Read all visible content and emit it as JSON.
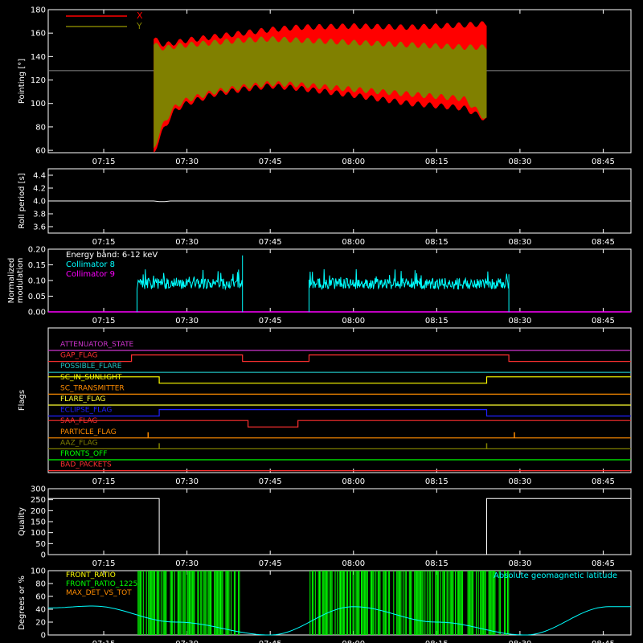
{
  "colors": {
    "x_series": "#ff0000",
    "y_series": "#808000",
    "collimator8": "#00ffff",
    "collimator9": "#ff00ff",
    "axis": "#ffffff",
    "front_ratio": "#ffff00",
    "front_ratio_1225": "#00ff00",
    "max_det": "#ff8c00",
    "geomag": "#00ffff"
  },
  "time_ticks": [
    "07:15",
    "07:30",
    "07:45",
    "08:00",
    "08:15",
    "08:30",
    "08:45"
  ],
  "chart_data": [
    {
      "type": "area",
      "ylabel": "Pointing [°]",
      "ylim": [
        58,
        180
      ],
      "yticks": [
        "180",
        "160",
        "140",
        "120",
        "100",
        "80",
        "60"
      ],
      "grid": false,
      "legend_placement": "top-left",
      "x_range": [
        "07:05",
        "08:50"
      ],
      "reference_line": 128,
      "series": [
        {
          "name": "X",
          "start": "07:24",
          "end": "08:24",
          "x": [
            "07:24",
            "07:26",
            "07:28",
            "07:30",
            "07:35",
            "07:40",
            "07:45",
            "07:50",
            "08:00",
            "08:10",
            "08:20",
            "08:24"
          ],
          "max": [
            155,
            150,
            152,
            154,
            157,
            160,
            163,
            165,
            166,
            165,
            167,
            168
          ],
          "min": [
            58,
            80,
            95,
            100,
            108,
            112,
            115,
            113,
            107,
            100,
            96,
            86
          ]
        },
        {
          "name": "Y",
          "start": "07:24",
          "end": "08:24",
          "x": [
            "07:24",
            "07:26",
            "07:28",
            "07:30",
            "07:35",
            "07:40",
            "07:45",
            "07:50",
            "08:00",
            "08:10",
            "08:20",
            "08:24"
          ],
          "max": [
            150,
            147,
            149,
            150,
            152,
            154,
            155,
            154,
            152,
            150,
            148,
            148
          ],
          "min": [
            62,
            85,
            98,
            103,
            110,
            114,
            117,
            116,
            112,
            108,
            104,
            86
          ]
        }
      ]
    },
    {
      "type": "line",
      "ylabel": "Roll period [s]",
      "ylim": [
        3.5,
        4.5
      ],
      "yticks": [
        "4.4",
        "4.2",
        "4.0",
        "3.8",
        "3.6"
      ],
      "grid": false,
      "series": [
        {
          "name": "",
          "x": [
            "07:05",
            "07:24",
            "07:25",
            "07:26",
            "07:27",
            "08:50"
          ],
          "values": [
            4.0,
            4.0,
            3.99,
            3.99,
            4.0,
            4.0
          ]
        }
      ]
    },
    {
      "type": "line",
      "ylabel": "Normalized modulation",
      "ylim": [
        0,
        0.2
      ],
      "yticks": [
        "0.20",
        "0.15",
        "0.10",
        "0.05",
        "0.00"
      ],
      "grid": false,
      "legend_placement": "top-left",
      "legend_title": "Energy band: 6-12 keV",
      "series": [
        {
          "name": "Collimator 8",
          "segments": [
            {
              "start": "07:21",
              "end": "07:40",
              "mean": 0.09,
              "peaks": [
                [
                  "07:21.5",
                  0.14
                ],
                [
                  "07:40",
                  0.18
                ]
              ]
            },
            {
              "start": "07:52",
              "end": "08:28",
              "mean": 0.09,
              "peaks": [
                [
                  "07:52.5",
                  0.13
                ],
                [
                  "08:28",
                  0.12
                ]
              ]
            }
          ]
        },
        {
          "name": "Collimator 9",
          "values": [
            0.0
          ]
        }
      ]
    },
    {
      "type": "line",
      "ylabel": "Flags",
      "grid": false,
      "flags": [
        {
          "name": "ATTENUATOR_STATE",
          "color": "#cc33cc",
          "transitions": []
        },
        {
          "name": "GAP_FLAG",
          "color": "#ff3030",
          "transitions": [
            [
              "07:05",
              0
            ],
            [
              "07:20",
              1
            ],
            [
              "07:40",
              0
            ],
            [
              "07:52",
              1
            ],
            [
              "08:28",
              0
            ]
          ]
        },
        {
          "name": "POSSIBLE_FLARE",
          "color": "#20c0c0",
          "transitions": []
        },
        {
          "name": "SC_IN_SUNLIGHT",
          "color": "#ffff00",
          "transitions": [
            [
              "07:05",
              1
            ],
            [
              "07:25",
              0
            ],
            [
              "08:24",
              1
            ]
          ]
        },
        {
          "name": "SC_TRANSMITTER",
          "color": "#ff8c00",
          "transitions": []
        },
        {
          "name": "FLARE_FLAG",
          "color": "#ffff30",
          "transitions": []
        },
        {
          "name": "ECLIPSE_FLAG",
          "color": "#2020ff",
          "transitions": [
            [
              "07:05",
              0
            ],
            [
              "07:25",
              1
            ],
            [
              "08:24",
              0
            ]
          ]
        },
        {
          "name": "SAA_FLAG",
          "color": "#ff3030",
          "transitions": [
            [
              "07:05",
              1
            ],
            [
              "07:41",
              0
            ],
            [
              "07:50",
              1
            ]
          ]
        },
        {
          "name": "PARTICLE_FLAG",
          "color": "#ff8c00",
          "spikes": [
            "07:23",
            "08:29"
          ]
        },
        {
          "name": "AAZ_FLAG",
          "color": "#808000",
          "spikes": [
            "07:25",
            "08:24"
          ]
        },
        {
          "name": "FRONTS_OFF",
          "color": "#00ff00",
          "transitions": []
        },
        {
          "name": "BAD_PACKETS",
          "color": "#ff3030",
          "transitions": []
        }
      ]
    },
    {
      "type": "line",
      "ylabel": "Quality",
      "ylim": [
        0,
        300
      ],
      "yticks": [
        "300",
        "250",
        "200",
        "150",
        "100",
        "50",
        "0"
      ],
      "grid": false,
      "series": [
        {
          "name": "",
          "x": [
            "07:05",
            "07:25",
            "07:25",
            "08:24",
            "08:24",
            "08:50"
          ],
          "values": [
            255,
            255,
            0,
            0,
            255,
            255
          ]
        }
      ]
    },
    {
      "type": "line",
      "ylabel": "Degrees or %",
      "ylim": [
        0,
        100
      ],
      "yticks": [
        "100",
        "80",
        "60",
        "40",
        "20",
        "0"
      ],
      "grid": false,
      "legend_placement": "top-left",
      "series": [
        {
          "name": "FRONT_RATIO",
          "values": []
        },
        {
          "name": "FRONT_RATIO_1225",
          "segments": [
            [
              "07:21",
              "07:40"
            ],
            [
              "07:52",
              "08:28"
            ]
          ]
        },
        {
          "name": "MAX_DET_VS_TOT",
          "values": []
        },
        {
          "name": "Absolute geomagnetic latitude",
          "x": [
            "07:05",
            "07:13",
            "07:28",
            "07:45",
            "08:00",
            "08:15",
            "08:31",
            "08:46",
            "08:50"
          ],
          "values": [
            42,
            45,
            20,
            0,
            44,
            20,
            0,
            44,
            44
          ]
        }
      ]
    }
  ]
}
